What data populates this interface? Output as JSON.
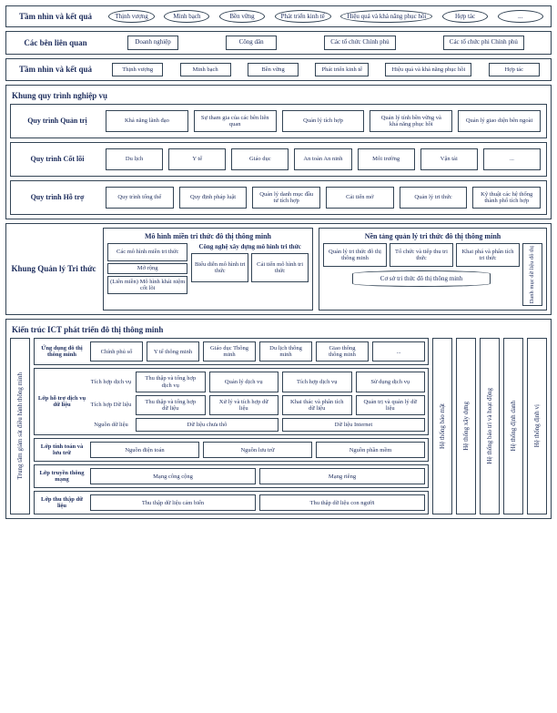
{
  "row1": {
    "label": "Tầm nhìn và kết quả",
    "items": [
      "Thịnh vượng",
      "Minh bạch",
      "Bền vững",
      "Phát triển kinh tế",
      "Hiệu quả và khả năng phục hồi",
      "Hợp tác",
      "..."
    ]
  },
  "row2": {
    "label": "Các bên liên quan",
    "items": [
      "Doanh nghiệp",
      "Công dân",
      "Các tổ chức Chính phủ",
      "Các tổ chức phi Chính phủ"
    ]
  },
  "row3": {
    "label": "Tầm nhìn và kết quả",
    "items": [
      "Thịnh vượng",
      "Minh bạch",
      "Bền vững",
      "Phát triển kinh tế",
      "Hiệu quả và khả năng phục hồi",
      "Hợp tác"
    ]
  },
  "biz": {
    "title": "Khung quy trình nghiệp vụ",
    "r1": {
      "label": "Quy trình Quản trị",
      "items": [
        "Khả năng lãnh đạo",
        "Sự tham gia của các bên liên quan",
        "Quản lý tích hợp",
        "Quản lý tính bền vững và khả năng phục hồi",
        "Quản lý giao diện bên ngoài"
      ]
    },
    "r2": {
      "label": "Quy trình Cốt lõi",
      "items": [
        "Du lịch",
        "Y tế",
        "Giáo dục",
        "An toàn An ninh",
        "Môi trường",
        "Vận tải",
        "..."
      ]
    },
    "r3": {
      "label": "Quy trình Hỗ trợ",
      "items": [
        "Quy trình tổng thể",
        "Quy định pháp luật",
        "Quản lý danh mục đầu tư tích hợp",
        "Cải tiến mở",
        "Quản lý tri thức",
        "Kỹ thuật các hệ thống thành phố tích hợp"
      ]
    }
  },
  "kf": {
    "label": "Khung Quản lý Tri thức",
    "left": {
      "title": "Mô hình miền tri thức đô thị thông minh",
      "c1": "Các mô hình miền tri thức",
      "c2": "Mở rộng",
      "c3": "(Liên miền) Mô hình khái niệm cốt lõi",
      "rtitle": "Công nghệ xây dựng mô hình tri thức",
      "r1": "Biểu diễn mô hình tri thức",
      "r2": "Cải tiến mô hình tri thức"
    },
    "right": {
      "title": "Nền tảng quản lý tri thức đô thị thông minh",
      "b1": "Quản lý tri thức đô thị thông minh",
      "b2": "Tổ chức và tiếp thu tri thức",
      "b3": "Khai phá và phân tích tri thức",
      "side": "Danh mục dữ liệu đô thị",
      "cyl": "Cơ sở tri thức đô thị thông minh"
    }
  },
  "ict": {
    "title": "Kiến trúc ICT phát triển đô thị thông minh",
    "leftSide": "Trung tâm giám sát điều hành thông minh",
    "t1": {
      "label": "Ứng dụng đô thị thông minh",
      "items": [
        "Chính phủ số",
        "Y tế thông minh",
        "Giáo dục Thông minh",
        "Du lịch thông minh",
        "Giao thông thông minh",
        "..."
      ]
    },
    "t2": {
      "label": "Lớp hỗ trợ dịch vụ dữ liệu",
      "rows": [
        {
          "lbl": "Tích hợp dịch vụ",
          "items": [
            "Thu thập và tổng hợp dịch vụ",
            "Quản lý dịch vụ",
            "Tích hợp dịch vụ",
            "Sử dụng dịch vụ"
          ]
        },
        {
          "lbl": "Tích hợp Dữ liệu",
          "items": [
            "Thu thập và tổng hợp dữ liệu",
            "Xử lý và tích hợp dữ liệu",
            "Khai thác và phân tích dữ liệu",
            "Quản trị và quản lý dữ liệu"
          ]
        },
        {
          "lbl": "Nguồn dữ liệu",
          "items": [
            "Dữ liệu chưa thô",
            "Dữ liệu Internet"
          ]
        }
      ]
    },
    "t3": {
      "label": "Lớp tính toán và lưu trữ",
      "items": [
        "Nguồn điện toán",
        "Nguồn lưu trữ",
        "Nguồn phần mềm"
      ]
    },
    "t4": {
      "label": "Lớp truyền thông mạng",
      "items": [
        "Mạng công cộng",
        "Mạng riêng"
      ]
    },
    "t5": {
      "label": "Lớp thu thập dữ liệu",
      "items": [
        "Thu thập dữ liệu cảm biến",
        "Thu thập dữ liệu con người"
      ]
    },
    "rights": [
      "Hệ thống bảo mật",
      "Hệ thống xây dựng",
      "Hệ thống bảo trì và hoạt động",
      "Hệ thống định danh",
      "Hệ thống định vị"
    ]
  }
}
